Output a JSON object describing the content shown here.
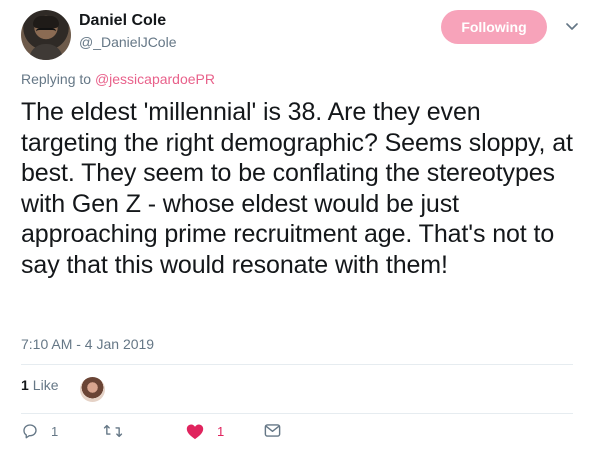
{
  "author": {
    "name": "Daniel Cole",
    "handle": "@_DanielJCole"
  },
  "follow_button": {
    "label": "Following"
  },
  "reply": {
    "prefix": "Replying to",
    "to_handle": "@jessicapardoePR"
  },
  "tweet": {
    "text": "The eldest 'millennial' is 38. Are they even targeting the right demographic? Seems sloppy, at best. They seem to be conflating the stereotypes with Gen Z - whose eldest would be just approaching prime recruitment age. That's not to say that this would resonate with them!",
    "timestamp": "7:10 AM - 4 Jan 2019"
  },
  "engagement": {
    "likes_count": "1",
    "likes_label": "Like"
  },
  "actions": {
    "reply_count": "1",
    "retweet_count": "",
    "like_count": "1"
  },
  "colors": {
    "follow_button_bg": "#f7a3ba",
    "like_active": "#e0245e",
    "secondary_text": "#657786"
  },
  "icons": [
    "chevron-down-icon",
    "reply-icon",
    "retweet-icon",
    "heart-icon",
    "message-icon"
  ]
}
